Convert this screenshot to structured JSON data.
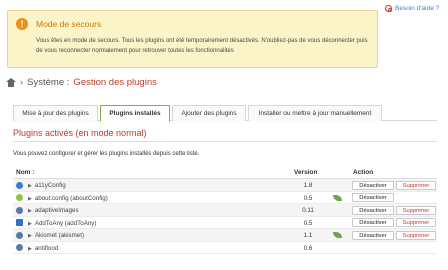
{
  "help": {
    "label": "Besoin d'aide ?",
    "icon": "help-lifebuoy-icon"
  },
  "alert": {
    "icon": "warning-icon",
    "title": "Mode de secours",
    "text": "Vous êtes en mode de secours. Tous les plugins ont été temporairement désactivés. N'oubliez-pas de vous déconnecter puis de vous reconnecter normalement pour retrouver toutes les fonctionnalités"
  },
  "breadcrumb": {
    "home_icon": "home-icon",
    "separator": "›",
    "system": "Système :",
    "page": "Gestion des plugins"
  },
  "tabs": [
    {
      "label": "Mise à jour des plugins"
    },
    {
      "label": "Plugins installés",
      "active": true
    },
    {
      "label": "Ajouter des plugins"
    },
    {
      "label": "Installer ou mettre à jour manuellement"
    }
  ],
  "section": {
    "title": "Plugins activés (en mode normal)",
    "intro": "Vous pouvez configurer et gérer les plugins installés depuis cette liste."
  },
  "table": {
    "headers": {
      "name": "Nom :",
      "version": "Version",
      "action": "Action"
    },
    "disable_label": "Désactiver",
    "delete_label": "Supprimer",
    "rows": [
      {
        "name": "a11yConfig",
        "version": "1.8",
        "icon": "info-icon",
        "icon_color": "#3d7cc9",
        "leaf": false,
        "delete": true
      },
      {
        "name": "about:config (aboutConfig)",
        "version": "0.5",
        "icon": "gear-icon",
        "icon_color": "#8bc34a",
        "leaf": true,
        "delete": false
      },
      {
        "name": "adaptiveImages",
        "version": "0.11",
        "icon": "power-icon",
        "icon_color": "#5a7aa3",
        "leaf": false,
        "delete": true
      },
      {
        "name": "AddToAny (addToAny)",
        "version": "0.5",
        "icon": "plus-icon",
        "icon_color": "#2f6fd0",
        "leaf": false,
        "delete": true
      },
      {
        "name": "Akismet (akismet)",
        "version": "1.1",
        "icon": "power-icon",
        "icon_color": "#5a7aa3",
        "leaf": true,
        "delete": true
      },
      {
        "name": "antiflood",
        "version": "0.6",
        "icon": "power-icon",
        "icon_color": "#5a7aa3",
        "leaf": false,
        "delete": false
      }
    ]
  },
  "colors": {
    "accent": "#c0392b",
    "alert_bg": "#fbf4c9",
    "alert_title": "#c77a10",
    "tab_active_border": "#7cb342"
  }
}
